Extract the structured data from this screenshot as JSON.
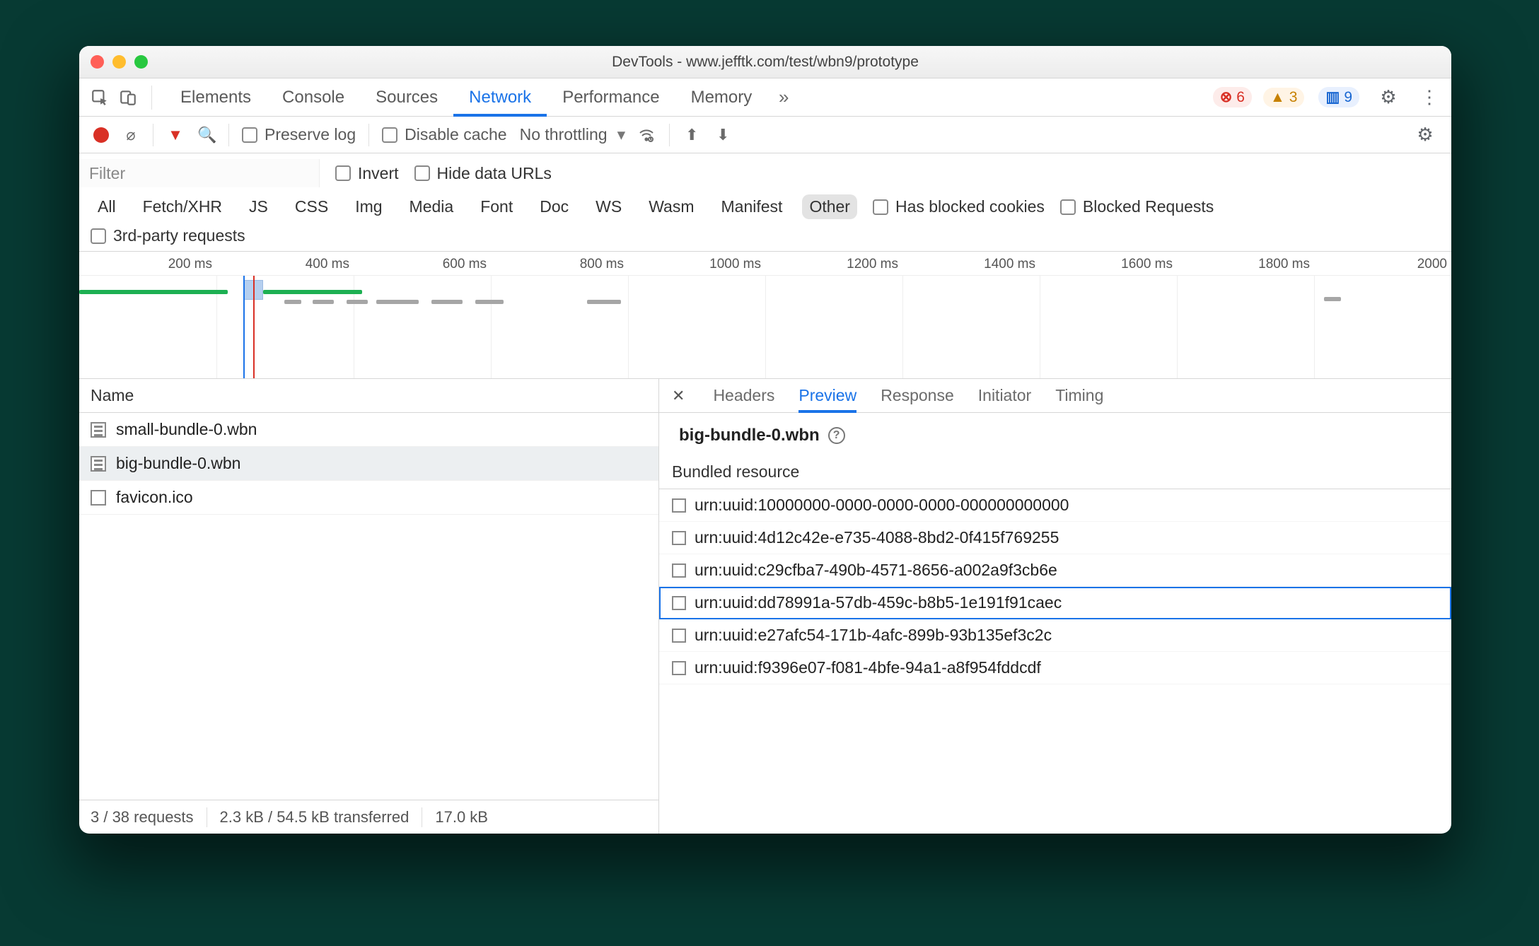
{
  "window": {
    "title": "DevTools - www.jefftk.com/test/wbn9/prototype"
  },
  "tabs": {
    "items": [
      "Elements",
      "Console",
      "Sources",
      "Network",
      "Performance",
      "Memory"
    ],
    "active": "Network",
    "overflow_glyph": "»"
  },
  "badges": {
    "errors": "6",
    "warnings": "3",
    "messages": "9"
  },
  "toolbar": {
    "preserve_log": "Preserve log",
    "disable_cache": "Disable cache",
    "throttling": "No throttling"
  },
  "filterbar": {
    "placeholder": "Filter",
    "invert": "Invert",
    "hide_data_urls": "Hide data URLs",
    "types": [
      "All",
      "Fetch/XHR",
      "JS",
      "CSS",
      "Img",
      "Media",
      "Font",
      "Doc",
      "WS",
      "Wasm",
      "Manifest",
      "Other"
    ],
    "active_type": "Other",
    "has_blocked_cookies": "Has blocked cookies",
    "blocked_requests": "Blocked Requests",
    "third_party": "3rd-party requests"
  },
  "timeline": {
    "ticks": [
      "200 ms",
      "400 ms",
      "600 ms",
      "800 ms",
      "1000 ms",
      "1200 ms",
      "1400 ms",
      "1600 ms",
      "1800 ms",
      "2000"
    ]
  },
  "left": {
    "header": "Name",
    "requests": [
      {
        "name": "small-bundle-0.wbn",
        "kind": "doc",
        "selected": false
      },
      {
        "name": "big-bundle-0.wbn",
        "kind": "doc",
        "selected": true
      },
      {
        "name": "favicon.ico",
        "kind": "other",
        "selected": false
      }
    ],
    "status": {
      "requests": "3 / 38 requests",
      "transferred": "2.3 kB / 54.5 kB transferred",
      "resources_prefix": "17.0 kB "
    }
  },
  "detail": {
    "tabs": [
      "Headers",
      "Preview",
      "Response",
      "Initiator",
      "Timing"
    ],
    "active": "Preview",
    "title": "big-bundle-0.wbn",
    "section": "Bundled resource",
    "resources": [
      "urn:uuid:10000000-0000-0000-0000-000000000000",
      "urn:uuid:4d12c42e-e735-4088-8bd2-0f415f769255",
      "urn:uuid:c29cfba7-490b-4571-8656-a002a9f3cb6e",
      "urn:uuid:dd78991a-57db-459c-b8b5-1e191f91caec",
      "urn:uuid:e27afc54-171b-4afc-899b-93b135ef3c2c",
      "urn:uuid:f9396e07-f081-4bfe-94a1-a8f954fddcdf"
    ],
    "selected_index": 3
  }
}
